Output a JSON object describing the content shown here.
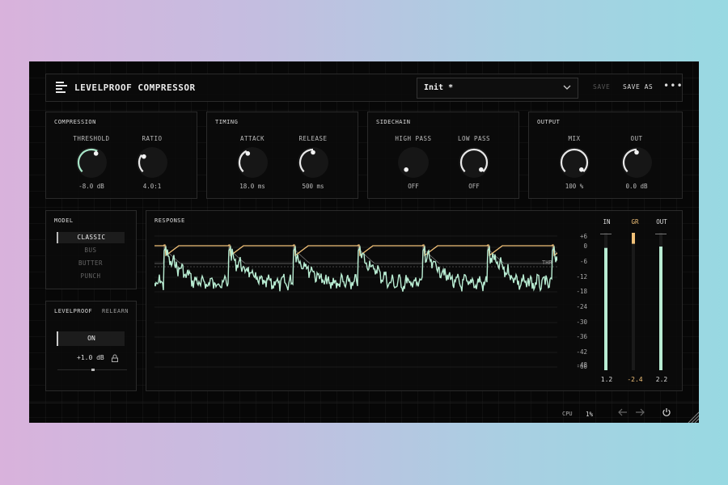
{
  "app": {
    "title": "LEVELPROOF COMPRESSOR"
  },
  "preset": {
    "name": "Init *"
  },
  "header": {
    "save_label": "SAVE",
    "save_as_label": "SAVE AS",
    "more_label": "•••"
  },
  "sections": {
    "compression": {
      "title": "COMPRESSION",
      "knobs": [
        {
          "label": "THRESHOLD",
          "value": "-8.0 dB",
          "fraction": 0.6
        },
        {
          "label": "RATIO",
          "value": "4.0:1",
          "fraction": 0.3
        }
      ]
    },
    "timing": {
      "title": "TIMING",
      "knobs": [
        {
          "label": "ATTACK",
          "value": "18.0 ms",
          "fraction": 0.4
        },
        {
          "label": "RELEASE",
          "value": "500 ms",
          "fraction": 0.5
        }
      ]
    },
    "sidechain": {
      "title": "SIDECHAIN",
      "knobs": [
        {
          "label": "HIGH PASS",
          "value": "OFF",
          "fraction": 0.0
        },
        {
          "label": "LOW PASS",
          "value": "OFF",
          "fraction": 1.0
        }
      ]
    },
    "output": {
      "title": "OUTPUT",
      "knobs": [
        {
          "label": "MIX",
          "value": "100 %",
          "fraction": 1.0
        },
        {
          "label": "OUT",
          "value": "0.0 dB",
          "fraction": 0.5
        }
      ]
    }
  },
  "model": {
    "title": "MODEL",
    "items": [
      "CLASSIC",
      "BUS",
      "BUTTER",
      "PUNCH"
    ],
    "selected": "CLASSIC"
  },
  "levelproof": {
    "title": "LEVELPROOF",
    "relearn_label": "RELEARN",
    "toggle_label": "ON",
    "value": "+1.0 dB"
  },
  "response": {
    "title": "RESPONSE",
    "threshold_label": "THR"
  },
  "meters": {
    "in_label": "IN",
    "gr_label": "GR",
    "out_label": "OUT",
    "scale": [
      "+6",
      "0",
      "-6",
      "-12",
      "-18",
      "-24",
      "-30",
      "-36",
      "-42",
      "-48",
      "-60"
    ],
    "in_value": "1.2",
    "gr_value": "-2.4",
    "out_value": "2.2",
    "in_level": 0.89,
    "out_level": 0.9,
    "gr_level": 0.08
  },
  "footer": {
    "cpu_label": "CPU",
    "cpu_value": "1%"
  },
  "colors": {
    "accent": "#a8e6c8",
    "gr": "#f0c078",
    "text": "#d8d8d8",
    "background": "#070707"
  }
}
